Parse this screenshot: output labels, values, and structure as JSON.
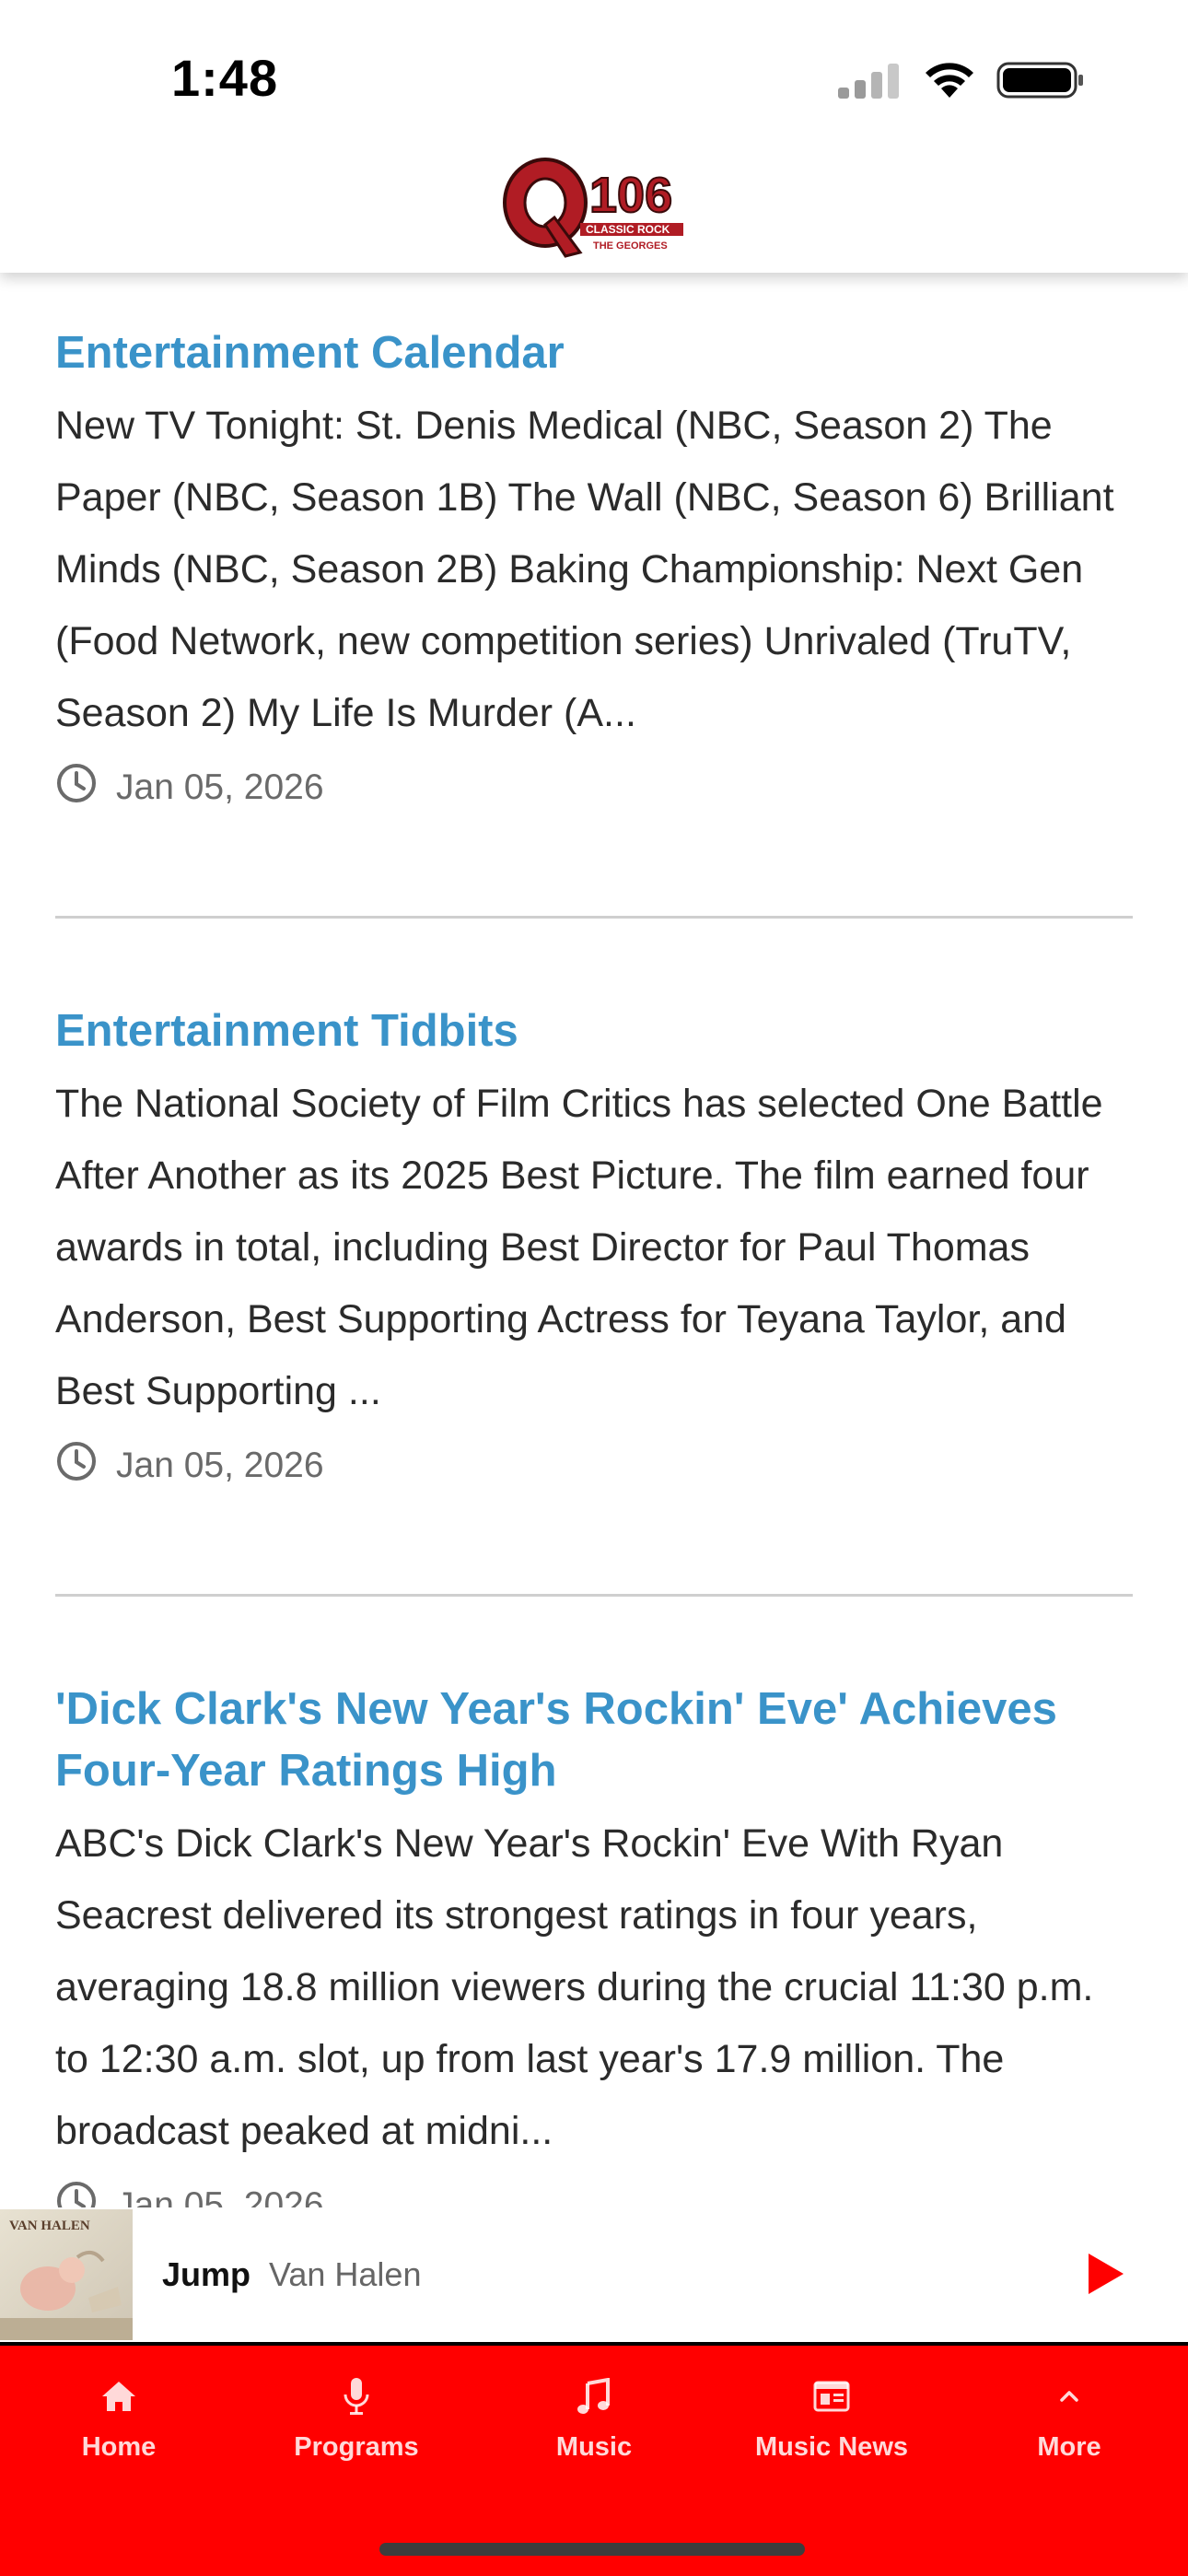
{
  "status_bar": {
    "time": "1:48"
  },
  "header": {
    "logo_text_main": "Q",
    "logo_text_number": "106",
    "logo_text_sub1": "CLASSIC ROCK",
    "logo_text_sub2": "THE GEORGES"
  },
  "articles": [
    {
      "title": "Entertainment Calendar",
      "excerpt": "New TV Tonight: St. Denis Medical (NBC, Season 2) The Paper (NBC, Season 1B) The Wall (NBC, Season 6) Brilliant Minds (NBC, Season 2B) Baking Championship: Next Gen (Food Network, new competition series) Unrivaled (TruTV, Season 2) My Life Is Murder (A...",
      "date": "Jan 05, 2026"
    },
    {
      "title": "Entertainment Tidbits",
      "excerpt": "The National Society of Film Critics has selected One Battle After Another as its 2025 Best Picture. The film earned four awards in total, including Best Director for Paul Thomas Anderson, Best Supporting Actress for Teyana Taylor, and Best Supporting ...",
      "date": "Jan 05, 2026"
    },
    {
      "title": "'Dick Clark's New Year's Rockin' Eve' Achieves Four-Year Ratings High",
      "excerpt": "ABC's Dick Clark's New Year's Rockin' Eve With Ryan Seacrest delivered its strongest ratings in four years, averaging 18.8 million viewers during the crucial 11:30 p.m. to 12:30 a.m. slot, up from last year's 17.9 million. The broadcast peaked at midni...",
      "date": "Jan 05, 2026"
    }
  ],
  "now_playing": {
    "album_text": "VAN HALEN",
    "title": "Jump",
    "artist": "Van Halen",
    "play_icon": "play-icon"
  },
  "tab_bar": {
    "items": [
      {
        "label": "Home",
        "icon": "home-icon"
      },
      {
        "label": "Programs",
        "icon": "microphone-icon"
      },
      {
        "label": "Music",
        "icon": "music-note-icon"
      },
      {
        "label": "Music News",
        "icon": "newspaper-icon"
      },
      {
        "label": "More",
        "icon": "chevron-up-icon"
      }
    ]
  },
  "colors": {
    "accent_blue": "#3a93c9",
    "tab_bar_red": "#ff0000",
    "logo_red": "#b01c24"
  }
}
